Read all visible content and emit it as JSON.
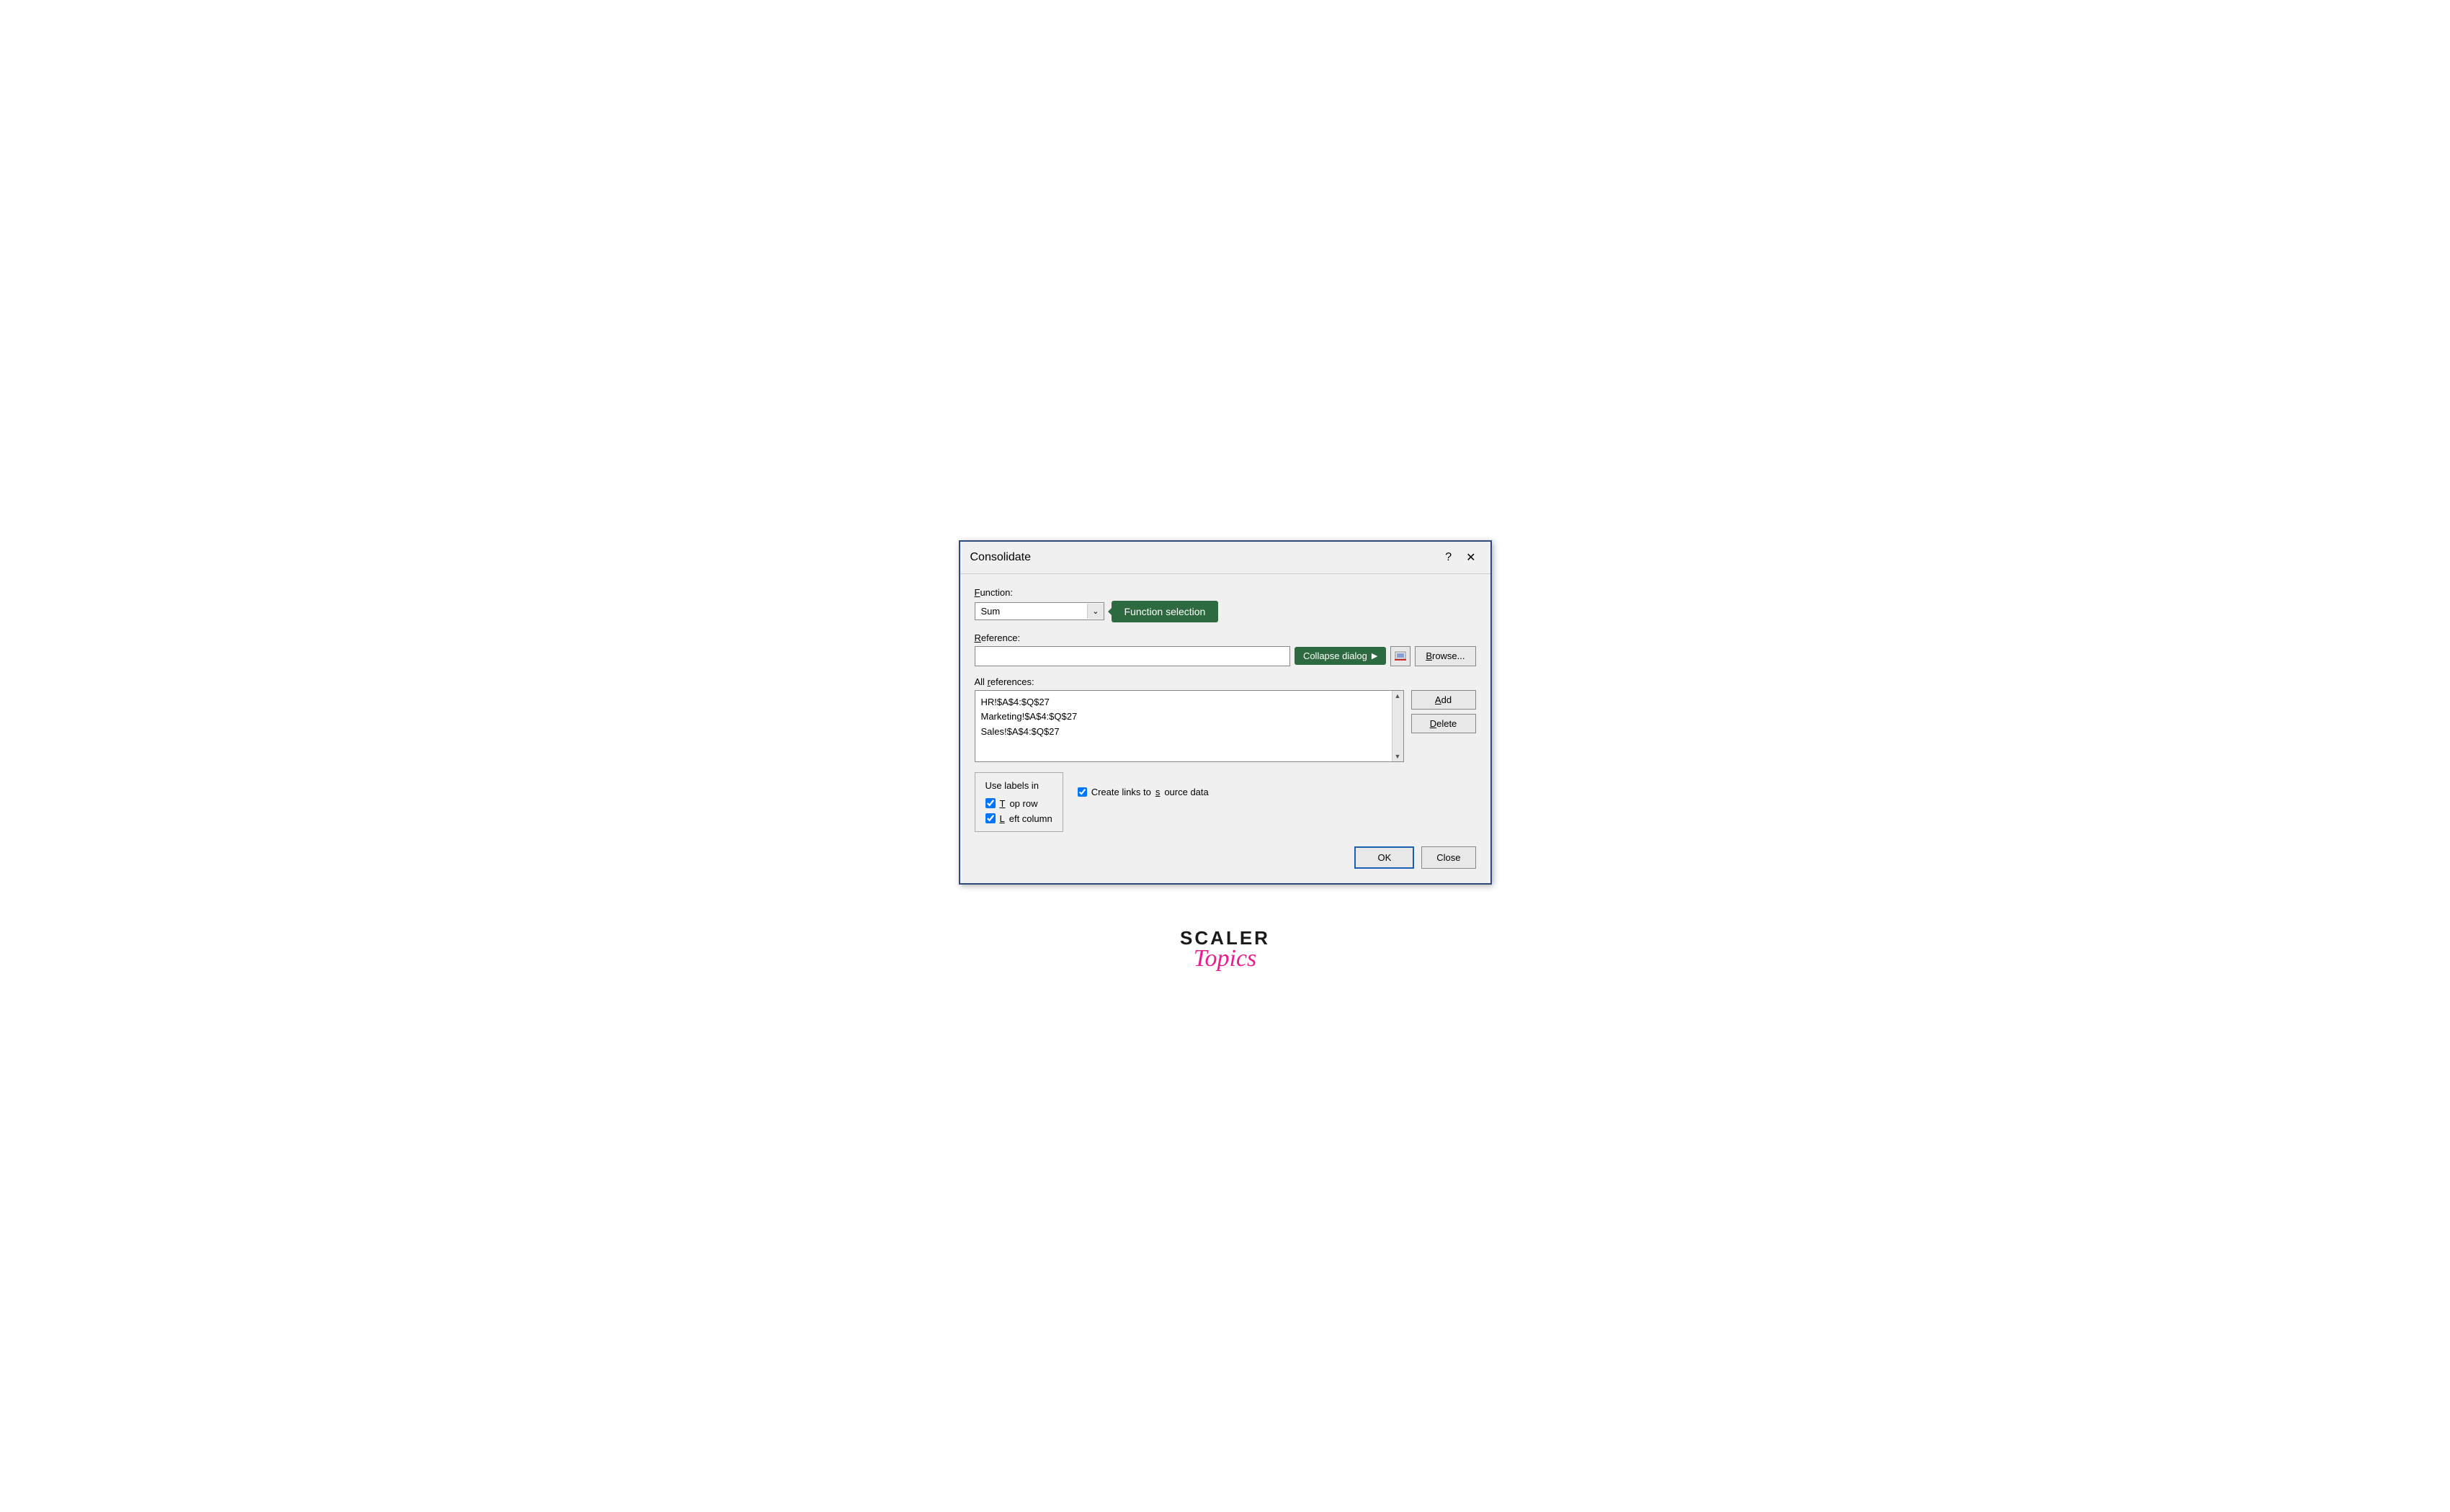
{
  "dialog": {
    "title": "Consolidate",
    "help_icon": "?",
    "close_icon": "✕",
    "function_label": "Function:",
    "function_underline_char": "F",
    "function_value": "Sum",
    "function_tooltip": "Function selection",
    "reference_label": "Reference:",
    "reference_underline_char": "R",
    "reference_placeholder": "",
    "collapse_dialog_label": "Collapse dialog",
    "browse_label": "Browse...",
    "browse_underline_char": "B",
    "all_references_label": "All references:",
    "all_references_underline_char": "r",
    "references": [
      "HR!$A$4:$Q$27",
      "Marketing!$A$4:$Q$27",
      "Sales!$A$4:$Q$27"
    ],
    "add_label": "Add",
    "add_underline_char": "A",
    "delete_label": "Delete",
    "delete_underline_char": "D",
    "use_labels_title": "Use labels in",
    "top_row_label": "Top row",
    "top_row_underline_char": "T",
    "left_column_label": "Left column",
    "left_column_underline_char": "L",
    "create_links_label": "Create links to source data",
    "create_links_underline_char": "s",
    "ok_label": "OK",
    "close_label": "Close"
  },
  "brand": {
    "scaler": "SCALER",
    "topics": "Topics"
  }
}
